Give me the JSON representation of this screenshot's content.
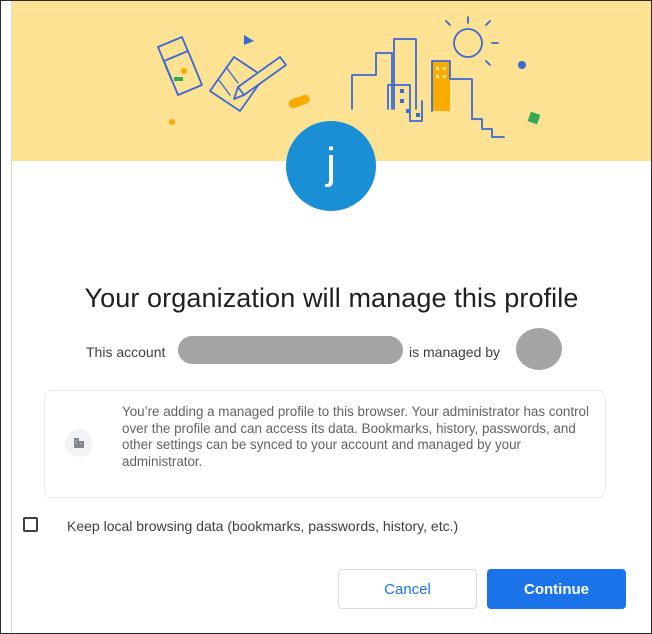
{
  "colors": {
    "banner": "#fde293",
    "avatar": "#1a8fd6",
    "primary": "#1a73e8",
    "redaction": "#a4a4a4"
  },
  "icons": {
    "avatar": "avatar-initial",
    "info": "building-icon"
  },
  "avatar": {
    "initial": "j"
  },
  "dialog": {
    "title": "Your organization will manage this profile",
    "account_prefix": "This account",
    "account_mid": "is managed by",
    "info_text": "You’re adding a managed profile to this browser. Your administrator has control over the profile and can access its data. Bookmarks, history, passwords, and other settings can be synced to your account and managed by your administrator.",
    "keep_data": {
      "label": "Keep local browsing data (bookmarks, passwords, history, etc.)",
      "checked": false
    }
  },
  "buttons": {
    "cancel": "Cancel",
    "continue": "Continue"
  }
}
